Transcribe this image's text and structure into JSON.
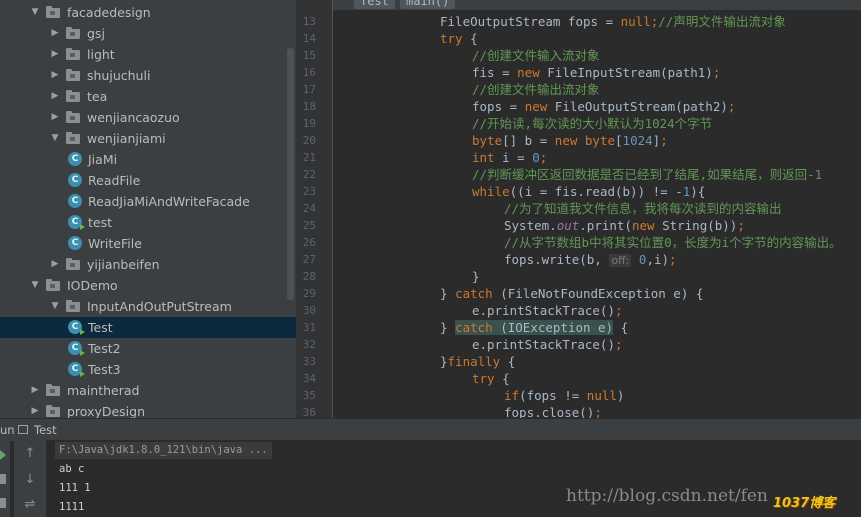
{
  "tree": {
    "items": [
      {
        "label": "facadedesign",
        "kind": "package",
        "expanded": true
      },
      {
        "label": "gsj",
        "kind": "package",
        "expanded": false
      },
      {
        "label": "light",
        "kind": "package",
        "expanded": false
      },
      {
        "label": "shujuchuli",
        "kind": "package",
        "expanded": false
      },
      {
        "label": "tea",
        "kind": "package",
        "expanded": false
      },
      {
        "label": "wenjiancaozuo",
        "kind": "package",
        "expanded": false
      },
      {
        "label": "wenjianjiami",
        "kind": "package",
        "expanded": true
      },
      {
        "label": "JiaMi",
        "kind": "class",
        "icon": "C"
      },
      {
        "label": "ReadFile",
        "kind": "class",
        "icon": "C"
      },
      {
        "label": "ReadJiaMiAndWriteFacade",
        "kind": "class",
        "icon": "C"
      },
      {
        "label": "test",
        "kind": "runnable-class",
        "icon": "C"
      },
      {
        "label": "WriteFile",
        "kind": "class",
        "icon": "C"
      },
      {
        "label": "yijianbeifen",
        "kind": "package",
        "expanded": false
      },
      {
        "label": "IODemo",
        "kind": "package",
        "expanded": true
      },
      {
        "label": "InputAndOutPutStream",
        "kind": "package",
        "expanded": true
      },
      {
        "label": "Test",
        "kind": "runnable-class",
        "icon": "C",
        "selected": true
      },
      {
        "label": "Test2",
        "kind": "runnable-class",
        "icon": "C"
      },
      {
        "label": "Test3",
        "kind": "runnable-class",
        "icon": "C"
      },
      {
        "label": "maintherad",
        "kind": "package",
        "expanded": false
      },
      {
        "label": "proxyDesign",
        "kind": "package",
        "expanded": false
      }
    ]
  },
  "editor": {
    "breadcrumbs": [
      "Test",
      "main()"
    ],
    "line_numbers": [
      "13",
      "14",
      "15",
      "16",
      "17",
      "18",
      "19",
      "20",
      "21",
      "22",
      "23",
      "24",
      "25",
      "26",
      "27",
      "28",
      "29",
      "30",
      "31",
      "32",
      "33",
      "34",
      "35",
      "36"
    ],
    "lines": [
      [
        {
          "t": "FileOutputStream fops = ",
          "c": ""
        },
        {
          "t": "null",
          "c": "kw"
        },
        {
          "t": ";",
          "c": "kw"
        },
        {
          "t": "//声明文件输出流对象",
          "c": "cm"
        }
      ],
      [
        {
          "t": "try ",
          "c": "kw"
        },
        {
          "t": "{",
          "c": ""
        }
      ],
      [
        {
          "t": "//创建文件输入流对象",
          "c": "cm"
        }
      ],
      [
        {
          "t": "fis = ",
          "c": ""
        },
        {
          "t": "new ",
          "c": "kw"
        },
        {
          "t": "FileInputStream(path1)",
          "c": ""
        },
        {
          "t": ";",
          "c": "kw"
        }
      ],
      [
        {
          "t": "//创建文件输出流对象",
          "c": "cm"
        }
      ],
      [
        {
          "t": "fops = ",
          "c": ""
        },
        {
          "t": "new ",
          "c": "kw"
        },
        {
          "t": "FileOutputStream(path2)",
          "c": ""
        },
        {
          "t": ";",
          "c": "kw"
        }
      ],
      [
        {
          "t": "//开始读,每次读的大小默认为1024个字节",
          "c": "cm"
        }
      ],
      [
        {
          "t": "byte",
          "c": "kw"
        },
        {
          "t": "[] b = ",
          "c": ""
        },
        {
          "t": "new byte",
          "c": "kw"
        },
        {
          "t": "[",
          "c": ""
        },
        {
          "t": "1024",
          "c": "num"
        },
        {
          "t": "]",
          "c": ""
        },
        {
          "t": ";",
          "c": "kw"
        }
      ],
      [
        {
          "t": "int ",
          "c": "kw"
        },
        {
          "t": "i = ",
          "c": ""
        },
        {
          "t": "0",
          "c": "num"
        },
        {
          "t": ";",
          "c": "kw"
        }
      ],
      [
        {
          "t": "//判断缓冲区返回数据是否已经到了结尾,如果结尾，则返回-1",
          "c": "cm"
        }
      ],
      [
        {
          "t": "while",
          "c": "kw"
        },
        {
          "t": "((i = fis.read(b)) != -",
          "c": ""
        },
        {
          "t": "1",
          "c": "num"
        },
        {
          "t": "){",
          "c": ""
        }
      ],
      [
        {
          "t": "//为了知道我文件信息，我将每次读到的内容输出",
          "c": "cm"
        }
      ],
      [
        {
          "t": "System.",
          "c": ""
        },
        {
          "t": "out",
          "c": "fld"
        },
        {
          "t": ".print(",
          "c": ""
        },
        {
          "t": "new ",
          "c": "kw"
        },
        {
          "t": "String(b))",
          "c": ""
        },
        {
          "t": ";",
          "c": "kw"
        }
      ],
      [
        {
          "t": "//从字节数组b中将其实位置0，长度为i个字节的内容输出。",
          "c": "cm"
        }
      ],
      [
        {
          "t": "fops.write(b, ",
          "c": ""
        },
        {
          "t": "off:",
          "c": "hint"
        },
        {
          "t": " ",
          "c": ""
        },
        {
          "t": "0",
          "c": "num"
        },
        {
          "t": ",i)",
          "c": ""
        },
        {
          "t": ";",
          "c": "kw"
        }
      ],
      [
        {
          "t": "}",
          "c": ""
        }
      ],
      [
        {
          "t": "} ",
          "c": ""
        },
        {
          "t": "catch ",
          "c": "kw"
        },
        {
          "t": "(FileNotFoundException e) {",
          "c": ""
        }
      ],
      [
        {
          "t": "e.printStackTrace()",
          "c": ""
        },
        {
          "t": ";",
          "c": "kw"
        }
      ],
      [
        {
          "t": "} ",
          "c": ""
        },
        {
          "t": "catch ",
          "c": "kw hl"
        },
        {
          "t": "(IOException e)",
          "c": "hl"
        },
        {
          "t": " {",
          "c": ""
        }
      ],
      [
        {
          "t": "e.printStackTrace()",
          "c": ""
        },
        {
          "t": ";",
          "c": "kw"
        }
      ],
      [
        {
          "t": "}",
          "c": ""
        },
        {
          "t": "finally ",
          "c": "kw"
        },
        {
          "t": "{",
          "c": ""
        }
      ],
      [
        {
          "t": "try ",
          "c": "kw"
        },
        {
          "t": "{",
          "c": ""
        }
      ],
      [
        {
          "t": "if",
          "c": "kw"
        },
        {
          "t": "(fops != ",
          "c": ""
        },
        {
          "t": "null",
          "c": "kw"
        },
        {
          "t": ")",
          "c": ""
        }
      ],
      [
        {
          "t": "fops.close()",
          "c": ""
        },
        {
          "t": ";",
          "c": "kw"
        }
      ]
    ]
  },
  "run": {
    "label": "un",
    "tab": "Test",
    "command": "F:\\Java\\jdk1.8.0_121\\bin\\java ...",
    "output": [
      "ab c",
      "111 1",
      "1111"
    ]
  },
  "watermark": {
    "url": "http://blog.csdn.net/fen",
    "badge": "1037博客"
  }
}
